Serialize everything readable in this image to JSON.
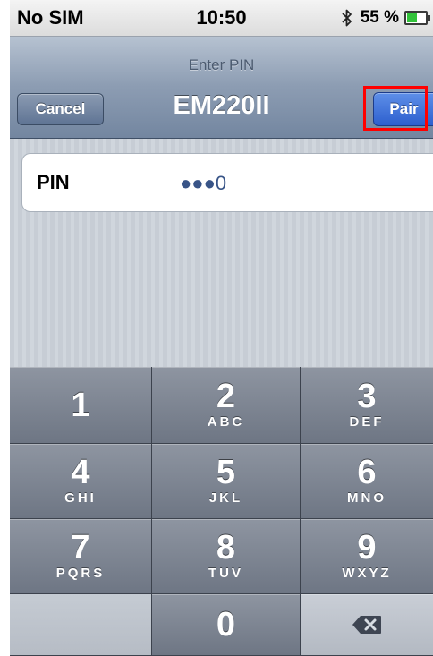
{
  "status_bar": {
    "carrier": "No SIM",
    "time": "10:50",
    "battery_percent": "55 %",
    "battery_level": 0.55,
    "icons": [
      "bluetooth-icon",
      "battery-icon"
    ]
  },
  "nav": {
    "prompt": "Enter PIN",
    "title": "EM220II",
    "cancel_label": "Cancel",
    "pair_label": "Pair"
  },
  "pin": {
    "label": "PIN",
    "value": "●●●0"
  },
  "keypad": {
    "keys": [
      {
        "digit": "1",
        "letters": ""
      },
      {
        "digit": "2",
        "letters": "ABC"
      },
      {
        "digit": "3",
        "letters": "DEF"
      },
      {
        "digit": "4",
        "letters": "GHI"
      },
      {
        "digit": "5",
        "letters": "JKL"
      },
      {
        "digit": "6",
        "letters": "MNO"
      },
      {
        "digit": "7",
        "letters": "PQRS"
      },
      {
        "digit": "8",
        "letters": "TUV"
      },
      {
        "digit": "9",
        "letters": "WXYZ"
      },
      {
        "digit": "0",
        "letters": ""
      }
    ],
    "delete_icon": "backspace-icon"
  },
  "colors": {
    "pair_button": "#2d5fce",
    "highlight_box": "#ff0000",
    "pin_dots": "#385487"
  }
}
